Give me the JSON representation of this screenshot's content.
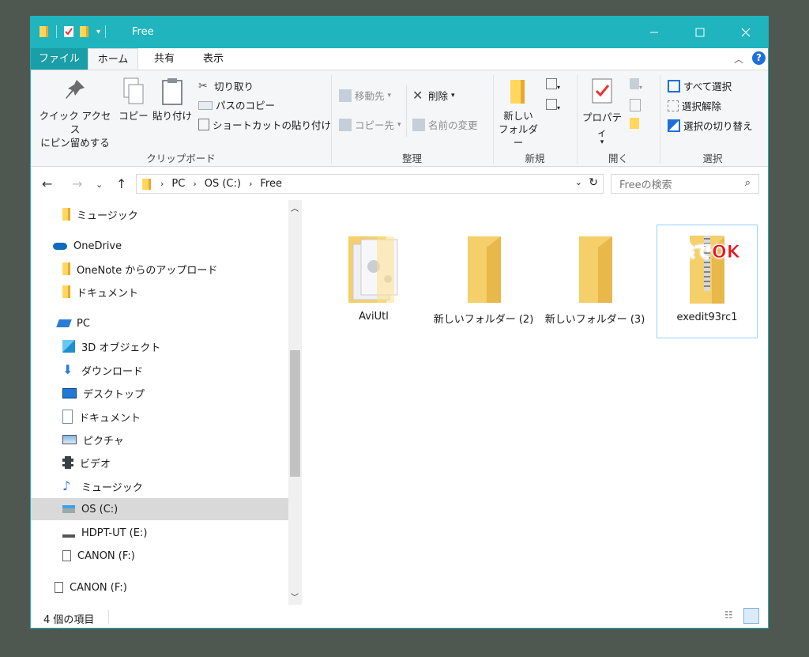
{
  "window": {
    "title": "Free"
  },
  "tabs": {
    "file": "ファイル",
    "home": "ホーム",
    "share": "共有",
    "view": "表示"
  },
  "ribbon": {
    "pin_line1": "クイック アクセス",
    "pin_line2": "にピン留めする",
    "copy": "コピー",
    "paste": "貼り付け",
    "cut": "切り取り",
    "copy_path": "パスのコピー",
    "paste_shortcut": "ショートカットの貼り付け",
    "clipboard_group": "クリップボード",
    "move_to": "移動先",
    "copy_to": "コピー先",
    "delete": "削除",
    "rename": "名前の変更",
    "organize_group": "整理",
    "new_folder_line1": "新しい",
    "new_folder_line2": "フォルダー",
    "new_group": "新規",
    "properties": "プロパティ",
    "open_group": "開く",
    "select_all": "すべて選択",
    "select_none": "選択解除",
    "invert_selection": "選択の切り替え",
    "select_group": "選択"
  },
  "address": {
    "crumbs": [
      "PC",
      "OS (C:)",
      "Free"
    ],
    "search_placeholder": "Freeの検索"
  },
  "nav": [
    {
      "label": "ミュージック",
      "icon": "folder-icon"
    },
    {
      "label": "OneDrive",
      "icon": "cloud-icon"
    },
    {
      "label": "OneNote からのアップロード",
      "icon": "folder-icon"
    },
    {
      "label": "ドキュメント",
      "icon": "folder-icon"
    },
    {
      "label": "PC",
      "icon": "pc-icon"
    },
    {
      "label": "3D オブジェクト",
      "icon": "cube-icon"
    },
    {
      "label": "ダウンロード",
      "icon": "download-icon"
    },
    {
      "label": "デスクトップ",
      "icon": "desktop-icon"
    },
    {
      "label": "ドキュメント",
      "icon": "document-icon"
    },
    {
      "label": "ピクチャ",
      "icon": "picture-icon"
    },
    {
      "label": "ビデオ",
      "icon": "video-icon"
    },
    {
      "label": "ミュージック",
      "icon": "music-icon"
    },
    {
      "label": "OS (C:)",
      "icon": "drive-icon"
    },
    {
      "label": "HDPT-UT (E:)",
      "icon": "usb-drive-icon"
    },
    {
      "label": "CANON (F:)",
      "icon": "sd-card-icon"
    },
    {
      "label": "CANON (F:)",
      "icon": "sd-card-icon"
    }
  ],
  "files": [
    {
      "name": "AviUtl",
      "icon": "app-folder-icon"
    },
    {
      "name": "新しいフォルダー (2)",
      "icon": "folder-icon"
    },
    {
      "name": "新しいフォルダー (3)",
      "icon": "folder-icon"
    },
    {
      "name": "exedit93rc1",
      "icon": "zip-folder-icon"
    }
  ],
  "annotation": "削除でOK",
  "status": {
    "count": "4 個の項目"
  },
  "colors": {
    "titlebar": "#1fb4be",
    "file_tab": "#1a9ea8",
    "annotation": "#e8141e"
  }
}
